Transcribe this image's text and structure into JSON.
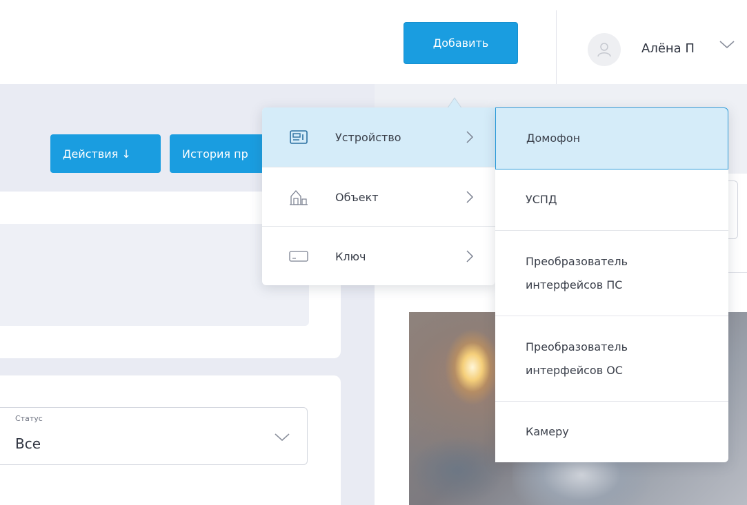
{
  "header": {
    "add_button_label": "Добавить",
    "user_name": "Алёна П"
  },
  "toolbar": {
    "actions_label": "Действия ↓",
    "history_label": "История пр"
  },
  "filter": {
    "status_label": "Статус",
    "status_value": "Все"
  },
  "menu": {
    "items": [
      {
        "label": "Устройство",
        "icon": "intercom-device-icon",
        "active": true
      },
      {
        "label": "Объект",
        "icon": "building-icon",
        "active": false
      },
      {
        "label": "Ключ",
        "icon": "key-card-icon",
        "active": false
      }
    ]
  },
  "submenu": {
    "items": [
      {
        "label": "Домофон",
        "active": true
      },
      {
        "label": "УСПД",
        "active": false
      },
      {
        "label": "Преобразователь интерфейсов ПС",
        "active": false
      },
      {
        "label": "Преобразователь интерфейсов ОС",
        "active": false
      },
      {
        "label": "Камеру",
        "active": false
      }
    ]
  },
  "colors": {
    "accent": "#1a9de0",
    "highlight": "#d5ecf9",
    "highlight_border": "#2a9ad9",
    "page_bg": "#e9ebf3"
  }
}
